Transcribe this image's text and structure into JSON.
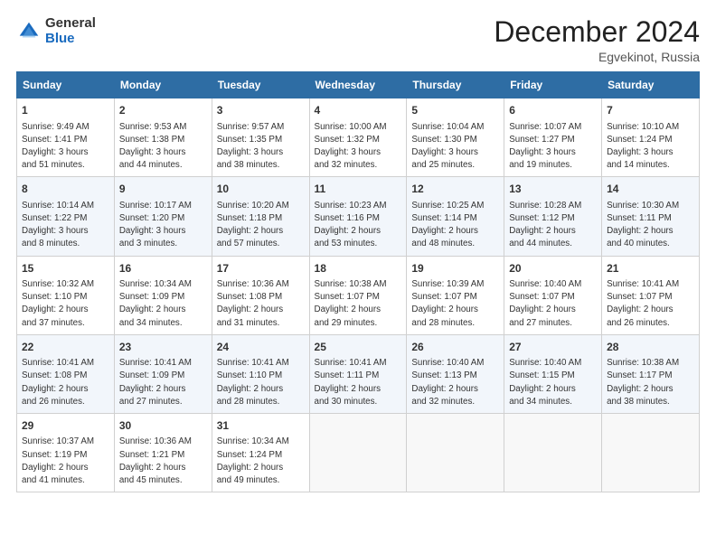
{
  "header": {
    "logo_general": "General",
    "logo_blue": "Blue",
    "month_title": "December 2024",
    "location": "Egvekinot, Russia"
  },
  "weekdays": [
    "Sunday",
    "Monday",
    "Tuesday",
    "Wednesday",
    "Thursday",
    "Friday",
    "Saturday"
  ],
  "weeks": [
    [
      {
        "day": "1",
        "detail": "Sunrise: 9:49 AM\nSunset: 1:41 PM\nDaylight: 3 hours\nand 51 minutes."
      },
      {
        "day": "2",
        "detail": "Sunrise: 9:53 AM\nSunset: 1:38 PM\nDaylight: 3 hours\nand 44 minutes."
      },
      {
        "day": "3",
        "detail": "Sunrise: 9:57 AM\nSunset: 1:35 PM\nDaylight: 3 hours\nand 38 minutes."
      },
      {
        "day": "4",
        "detail": "Sunrise: 10:00 AM\nSunset: 1:32 PM\nDaylight: 3 hours\nand 32 minutes."
      },
      {
        "day": "5",
        "detail": "Sunrise: 10:04 AM\nSunset: 1:30 PM\nDaylight: 3 hours\nand 25 minutes."
      },
      {
        "day": "6",
        "detail": "Sunrise: 10:07 AM\nSunset: 1:27 PM\nDaylight: 3 hours\nand 19 minutes."
      },
      {
        "day": "7",
        "detail": "Sunrise: 10:10 AM\nSunset: 1:24 PM\nDaylight: 3 hours\nand 14 minutes."
      }
    ],
    [
      {
        "day": "8",
        "detail": "Sunrise: 10:14 AM\nSunset: 1:22 PM\nDaylight: 3 hours\nand 8 minutes."
      },
      {
        "day": "9",
        "detail": "Sunrise: 10:17 AM\nSunset: 1:20 PM\nDaylight: 3 hours\nand 3 minutes."
      },
      {
        "day": "10",
        "detail": "Sunrise: 10:20 AM\nSunset: 1:18 PM\nDaylight: 2 hours\nand 57 minutes."
      },
      {
        "day": "11",
        "detail": "Sunrise: 10:23 AM\nSunset: 1:16 PM\nDaylight: 2 hours\nand 53 minutes."
      },
      {
        "day": "12",
        "detail": "Sunrise: 10:25 AM\nSunset: 1:14 PM\nDaylight: 2 hours\nand 48 minutes."
      },
      {
        "day": "13",
        "detail": "Sunrise: 10:28 AM\nSunset: 1:12 PM\nDaylight: 2 hours\nand 44 minutes."
      },
      {
        "day": "14",
        "detail": "Sunrise: 10:30 AM\nSunset: 1:11 PM\nDaylight: 2 hours\nand 40 minutes."
      }
    ],
    [
      {
        "day": "15",
        "detail": "Sunrise: 10:32 AM\nSunset: 1:10 PM\nDaylight: 2 hours\nand 37 minutes."
      },
      {
        "day": "16",
        "detail": "Sunrise: 10:34 AM\nSunset: 1:09 PM\nDaylight: 2 hours\nand 34 minutes."
      },
      {
        "day": "17",
        "detail": "Sunrise: 10:36 AM\nSunset: 1:08 PM\nDaylight: 2 hours\nand 31 minutes."
      },
      {
        "day": "18",
        "detail": "Sunrise: 10:38 AM\nSunset: 1:07 PM\nDaylight: 2 hours\nand 29 minutes."
      },
      {
        "day": "19",
        "detail": "Sunrise: 10:39 AM\nSunset: 1:07 PM\nDaylight: 2 hours\nand 28 minutes."
      },
      {
        "day": "20",
        "detail": "Sunrise: 10:40 AM\nSunset: 1:07 PM\nDaylight: 2 hours\nand 27 minutes."
      },
      {
        "day": "21",
        "detail": "Sunrise: 10:41 AM\nSunset: 1:07 PM\nDaylight: 2 hours\nand 26 minutes."
      }
    ],
    [
      {
        "day": "22",
        "detail": "Sunrise: 10:41 AM\nSunset: 1:08 PM\nDaylight: 2 hours\nand 26 minutes."
      },
      {
        "day": "23",
        "detail": "Sunrise: 10:41 AM\nSunset: 1:09 PM\nDaylight: 2 hours\nand 27 minutes."
      },
      {
        "day": "24",
        "detail": "Sunrise: 10:41 AM\nSunset: 1:10 PM\nDaylight: 2 hours\nand 28 minutes."
      },
      {
        "day": "25",
        "detail": "Sunrise: 10:41 AM\nSunset: 1:11 PM\nDaylight: 2 hours\nand 30 minutes."
      },
      {
        "day": "26",
        "detail": "Sunrise: 10:40 AM\nSunset: 1:13 PM\nDaylight: 2 hours\nand 32 minutes."
      },
      {
        "day": "27",
        "detail": "Sunrise: 10:40 AM\nSunset: 1:15 PM\nDaylight: 2 hours\nand 34 minutes."
      },
      {
        "day": "28",
        "detail": "Sunrise: 10:38 AM\nSunset: 1:17 PM\nDaylight: 2 hours\nand 38 minutes."
      }
    ],
    [
      {
        "day": "29",
        "detail": "Sunrise: 10:37 AM\nSunset: 1:19 PM\nDaylight: 2 hours\nand 41 minutes."
      },
      {
        "day": "30",
        "detail": "Sunrise: 10:36 AM\nSunset: 1:21 PM\nDaylight: 2 hours\nand 45 minutes."
      },
      {
        "day": "31",
        "detail": "Sunrise: 10:34 AM\nSunset: 1:24 PM\nDaylight: 2 hours\nand 49 minutes."
      },
      {
        "day": "",
        "detail": ""
      },
      {
        "day": "",
        "detail": ""
      },
      {
        "day": "",
        "detail": ""
      },
      {
        "day": "",
        "detail": ""
      }
    ]
  ]
}
